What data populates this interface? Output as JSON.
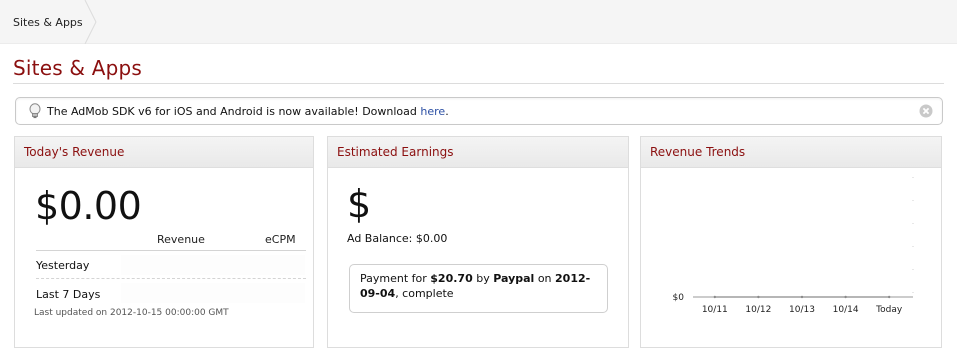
{
  "breadcrumb": {
    "current": "Sites & Apps"
  },
  "page": {
    "title": "Sites & Apps"
  },
  "notice": {
    "text": "The AdMob SDK v6 for iOS and Android is now available! Download ",
    "link_text": "here",
    "suffix": "."
  },
  "todays_revenue": {
    "title": "Today's Revenue",
    "amount": "$0.00",
    "columns": [
      "Revenue",
      "eCPM"
    ],
    "rows": [
      {
        "label": "Yesterday"
      },
      {
        "label": "Last 7 Days"
      }
    ],
    "last_updated": "Last updated on 2012-10-15 00:00:00 GMT"
  },
  "estimated_earnings": {
    "title": "Estimated Earnings",
    "currency_symbol": "$",
    "ad_balance": "Ad Balance: $0.00",
    "payment": {
      "prefix": "Payment for ",
      "amount": "$20.70",
      "by_text": " by ",
      "method": "Paypal",
      "on_text": " on ",
      "date": "2012-09-04",
      "suffix": ", complete"
    }
  },
  "revenue_trends": {
    "title": "Revenue Trends"
  },
  "chart_data": {
    "type": "line",
    "title": "",
    "categories": [
      "10/11",
      "10/12",
      "10/13",
      "10/14",
      "Today"
    ],
    "series": [
      {
        "values": [
          0,
          0,
          0,
          0,
          0
        ]
      }
    ],
    "y_tick_labels": [
      "$0"
    ],
    "ylim": [
      0,
      1
    ],
    "grid": false
  },
  "colors": {
    "title_red": "#8b0f0f",
    "link_blue": "#2a4ea3",
    "panel_header": "#ececec"
  },
  "icons": {
    "notice": "lightbulb-icon",
    "dismiss": "close-icon"
  }
}
